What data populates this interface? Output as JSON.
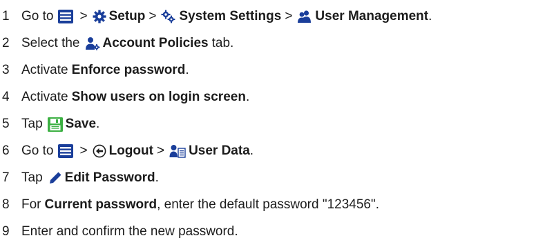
{
  "steps": [
    {
      "number": "1",
      "text": {
        "go_to": "Go to",
        "gt1": ">",
        "setup": "Setup",
        "gt2": ">",
        "system_settings": "System Settings",
        "gt3": ">",
        "user_management": "User Management",
        "end": "."
      }
    },
    {
      "number": "2",
      "text": {
        "pre": "Select the",
        "account_policies": "Account Policies",
        "post": "tab."
      }
    },
    {
      "number": "3",
      "text": {
        "pre": "Activate",
        "label": "Enforce password",
        "end": "."
      }
    },
    {
      "number": "4",
      "text": {
        "pre": "Activate",
        "label": "Show users on login screen",
        "end": "."
      }
    },
    {
      "number": "5",
      "text": {
        "pre": "Tap",
        "save": "Save",
        "end": "."
      }
    },
    {
      "number": "6",
      "text": {
        "go_to": "Go to",
        "gt1": ">",
        "logout": "Logout",
        "gt2": ">",
        "user_data": "User Data",
        "end": "."
      }
    },
    {
      "number": "7",
      "text": {
        "pre": "Tap",
        "edit_password": "Edit Password",
        "end": "."
      }
    },
    {
      "number": "8",
      "text": {
        "pre": "For",
        "current_password": "Current password",
        "post": ", enter the default password \"123456\"."
      }
    },
    {
      "number": "9",
      "text": {
        "full": "Enter and confirm the new password."
      }
    }
  ],
  "icons": {
    "menu": "hamburger-menu-icon",
    "setup": "gear-icon",
    "system_settings": "double-gear-icon",
    "user_management": "users-icon",
    "account_policies": "user-gear-icon",
    "save": "floppy-disk-icon",
    "logout": "circle-arrow-left-icon",
    "user_data": "user-list-icon",
    "edit_password": "pencil-icon"
  },
  "colors": {
    "text": "#1c1c1c",
    "icon_blue": "#1a3e9a",
    "save_green": "#3cb043"
  }
}
